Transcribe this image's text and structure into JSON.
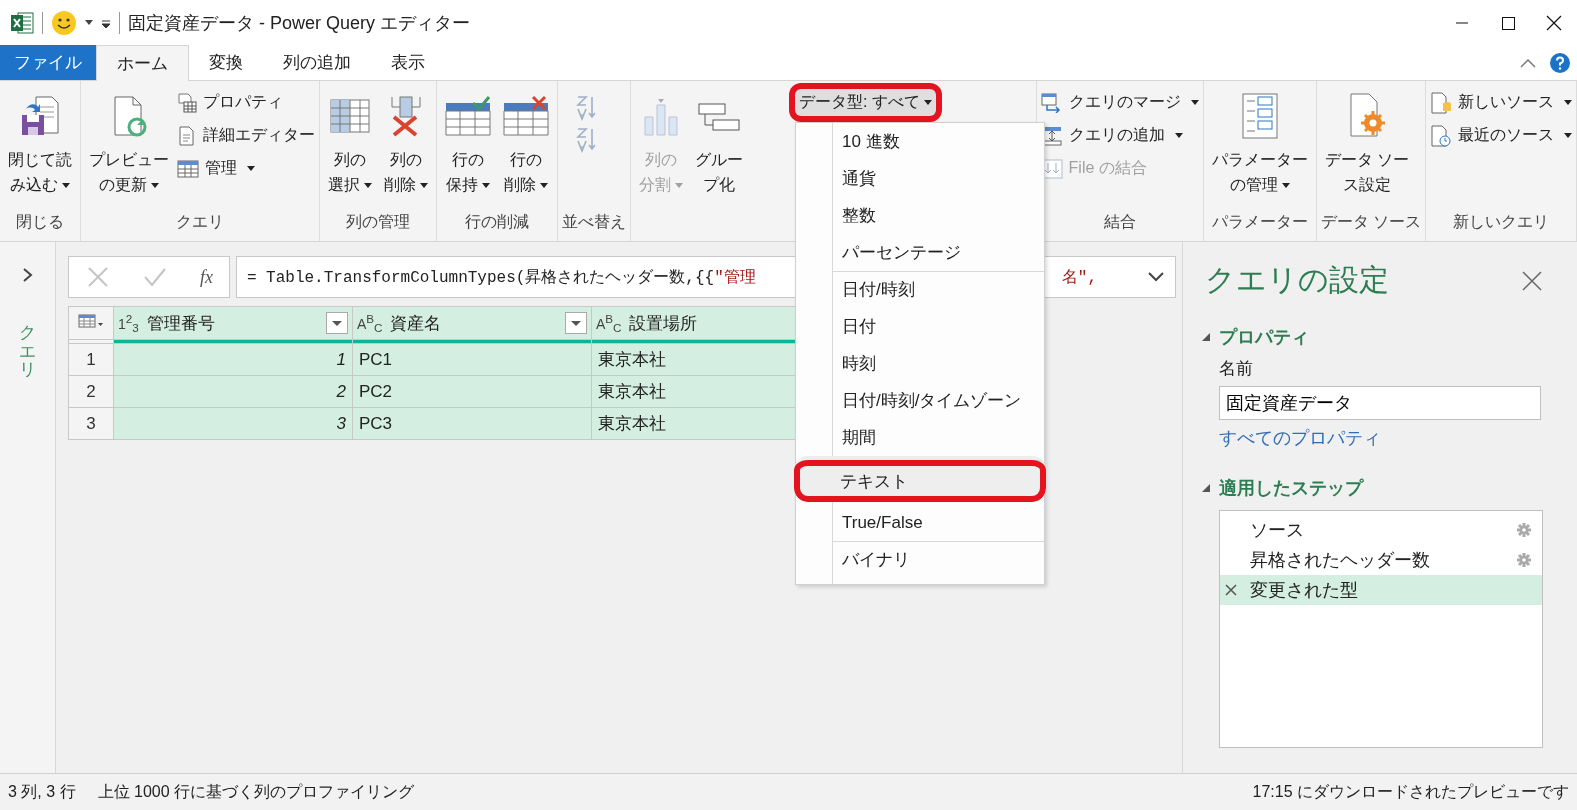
{
  "title_bar": {
    "title": "固定資産データ - Power Query エディター"
  },
  "tabs": [
    {
      "label": "ファイル",
      "kind": "file",
      "selected": false
    },
    {
      "label": "ホーム",
      "kind": "tab",
      "selected": true
    },
    {
      "label": "変換",
      "kind": "tab",
      "selected": false
    },
    {
      "label": "列の追加",
      "kind": "tab",
      "selected": false
    },
    {
      "label": "表示",
      "kind": "tab",
      "selected": false
    }
  ],
  "ribbon": {
    "groups": [
      {
        "label": "閉じる",
        "columns": [
          {
            "kind": "large",
            "lines": [
              "閉じて読",
              "み込む"
            ],
            "caret": true,
            "disabled": false
          }
        ]
      },
      {
        "label": "クエリ",
        "columns": [
          {
            "kind": "large",
            "lines": [
              "プレビュー",
              "の更新"
            ],
            "caret": true,
            "disabled": false
          },
          {
            "kind": "stack",
            "items": [
              {
                "label": "プロパティ",
                "caret": false,
                "disabled": false
              },
              {
                "label": "詳細エディター",
                "caret": false,
                "disabled": false
              },
              {
                "label": "管理",
                "caret": true,
                "disabled": false
              }
            ]
          }
        ]
      },
      {
        "label": "列の管理",
        "columns": [
          {
            "kind": "large",
            "lines": [
              "列の",
              "選択"
            ],
            "caret": true,
            "disabled": false
          },
          {
            "kind": "large",
            "lines": [
              "列の",
              "削除"
            ],
            "caret": true,
            "disabled": false
          }
        ]
      },
      {
        "label": "行の削減",
        "columns": [
          {
            "kind": "large",
            "lines": [
              "行の",
              "保持"
            ],
            "caret": true,
            "disabled": false
          },
          {
            "kind": "large",
            "lines": [
              "行の",
              "削除"
            ],
            "caret": true,
            "disabled": false
          }
        ]
      },
      {
        "label": "並べ替え",
        "columns": [
          {
            "kind": "sort",
            "disabled": true
          }
        ]
      },
      {
        "columns": [
          {
            "kind": "large",
            "lines": [
              "列の",
              "分割"
            ],
            "caret": true,
            "disabled": true
          },
          {
            "kind": "large",
            "lines": [
              "グルー",
              "プ化"
            ],
            "caret": false,
            "disabled": false
          },
          {
            "kind": "datatype",
            "label": "データ型: すべて",
            "caret": true,
            "annotated": true
          }
        ]
      },
      {
        "label": "結合",
        "columns": [
          {
            "kind": "stack",
            "items": [
              {
                "label": "クエリのマージ",
                "caret": true,
                "disabled": false
              },
              {
                "label": "クエリの追加",
                "caret": true,
                "disabled": false
              },
              {
                "label": "File の結合",
                "caret": false,
                "disabled": true
              }
            ]
          }
        ]
      },
      {
        "label": "パラメーター",
        "columns": [
          {
            "kind": "large",
            "lines": [
              "パラメーター",
              "の管理"
            ],
            "caret": true,
            "disabled": false
          }
        ]
      },
      {
        "label": "データ ソース",
        "columns": [
          {
            "kind": "large",
            "lines": [
              "データ ソー",
              "ス設定"
            ],
            "caret": false,
            "disabled": false
          }
        ]
      },
      {
        "label": "新しいクエリ",
        "columns": [
          {
            "kind": "stack",
            "items": [
              {
                "label": "新しいソース",
                "caret": true,
                "disabled": false
              },
              {
                "label": "最近のソース",
                "caret": true,
                "disabled": false
              }
            ]
          }
        ]
      }
    ]
  },
  "queries_pane": {
    "label": "クエリ",
    "expanded": false
  },
  "formula_bar": {
    "fx": "fx",
    "head": "= Table.TransformColumnTypes(昇格されたヘッダー数,{{",
    "string_head": "\"管理",
    "tail": "名\","
  },
  "table": {
    "columns": [
      {
        "type": "1$^{2}$$_{3}$",
        "name": "管理番号",
        "kind": "number"
      },
      {
        "type": "A$^{B}$$_{C}$",
        "name": "資産名",
        "kind": "text"
      },
      {
        "type": "A$^{B}$$_{C}$",
        "name": "設置場所",
        "kind": "text"
      }
    ],
    "rows": [
      {
        "number": "1",
        "cells": [
          "1",
          "PC1",
          "東京本社"
        ]
      },
      {
        "number": "2",
        "cells": [
          "2",
          "PC2",
          "東京本社"
        ]
      },
      {
        "number": "3",
        "cells": [
          "3",
          "PC3",
          "東京本社"
        ]
      }
    ]
  },
  "datatype_menu": [
    {
      "label": "10 進数",
      "separator_before": false,
      "highlighted": false,
      "annotated": false
    },
    {
      "label": "通貨",
      "separator_before": false,
      "highlighted": false,
      "annotated": false
    },
    {
      "label": "整数",
      "separator_before": false,
      "highlighted": false,
      "annotated": false
    },
    {
      "label": "パーセンテージ",
      "separator_before": false,
      "highlighted": false,
      "annotated": false
    },
    {
      "label": "日付/時刻",
      "separator_before": true,
      "highlighted": false,
      "annotated": false
    },
    {
      "label": "日付",
      "separator_before": false,
      "highlighted": false,
      "annotated": false
    },
    {
      "label": "時刻",
      "separator_before": false,
      "highlighted": false,
      "annotated": false
    },
    {
      "label": "日付/時刻/タイムゾーン",
      "separator_before": false,
      "highlighted": false,
      "annotated": false
    },
    {
      "label": "期間",
      "separator_before": false,
      "highlighted": false,
      "annotated": false
    },
    {
      "label": "テキスト",
      "separator_before": true,
      "highlighted": true,
      "annotated": true
    },
    {
      "label": "True/False",
      "separator_before": false,
      "highlighted": false,
      "annotated": false
    },
    {
      "label": "バイナリ",
      "separator_before": true,
      "highlighted": false,
      "annotated": false
    }
  ],
  "query_settings": {
    "title": "クエリの設定",
    "properties": {
      "heading": "プロパティ",
      "expanded": true,
      "name_label": "名前",
      "name_value": "固定資産データ",
      "all_properties_link": "すべてのプロパティ"
    },
    "applied_steps": {
      "heading": "適用したステップ",
      "expanded": true,
      "steps": [
        {
          "label": "ソース",
          "has_settings": true,
          "selected": false
        },
        {
          "label": "昇格されたヘッダー数",
          "has_settings": true,
          "selected": false
        },
        {
          "label": "変更された型",
          "has_settings": false,
          "selected": true
        }
      ]
    }
  },
  "status_bar": {
    "counts": "3 列, 3 行",
    "profiling": "上位 1000 行に基づく列のプロファイリング",
    "preview": "17:15 にダウンロードされたプレビューです"
  }
}
